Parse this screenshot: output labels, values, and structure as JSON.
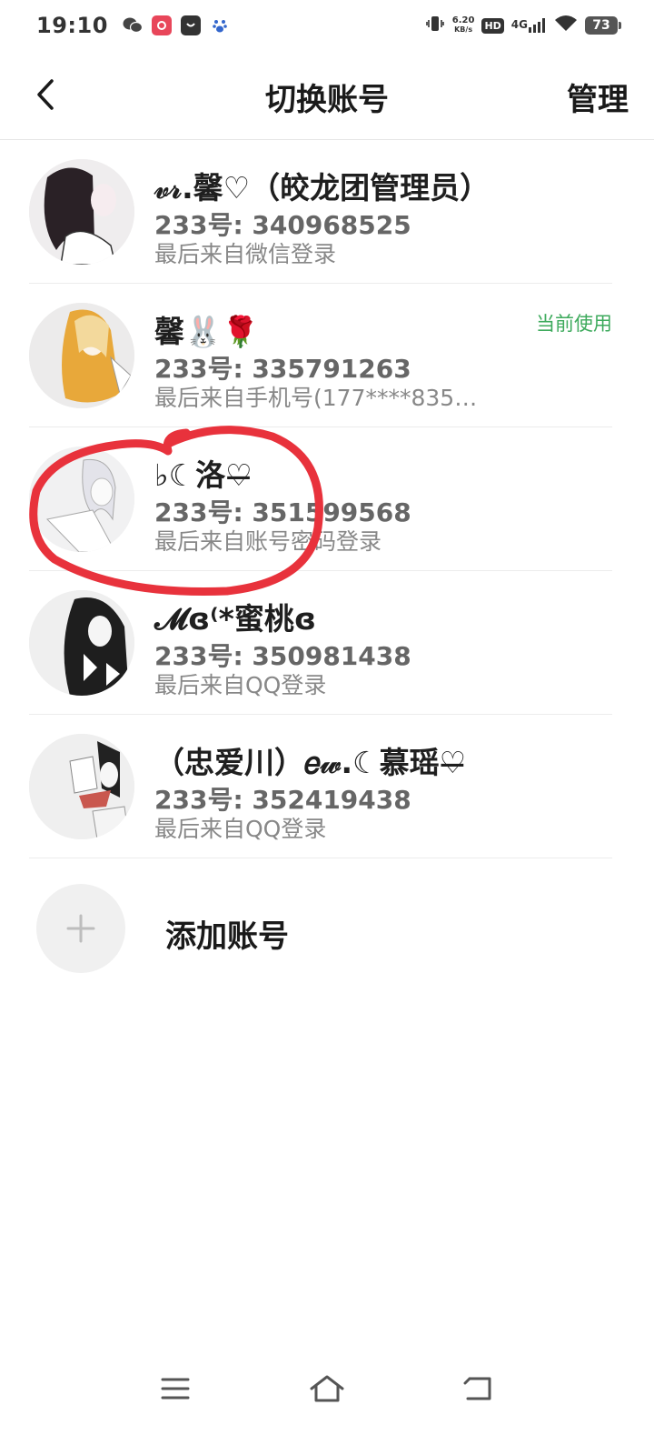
{
  "status_bar": {
    "time": "19:10",
    "speed_value": "6.20",
    "speed_unit": "KB/s",
    "hd": "HD",
    "network": "4G",
    "battery": "73",
    "icons": [
      "wechat-icon",
      "app-red-icon",
      "app-bag-icon",
      "baidu-paw-icon",
      "vibrate-icon",
      "signal-icon",
      "wifi-icon",
      "battery-icon"
    ]
  },
  "header": {
    "title": "切换账号",
    "manage_label": "管理"
  },
  "accounts": [
    {
      "name": "𝓋𝓇.馨♡（皎龙团管理员）",
      "id_line": "233号: 340968525",
      "source": "最后来自微信登录",
      "current": ""
    },
    {
      "name": "馨🐰🌹",
      "id_line": "233号: 335791263",
      "source": "最后来自手机号(177****835…",
      "current": "当前使用"
    },
    {
      "name": "♭☾洛♡̶",
      "id_line": "233号: 351599568",
      "source": "最后来自账号密码登录",
      "current": ""
    },
    {
      "name": "𝓜ɞ⁽*蜜桃ɞ",
      "id_line": "233号: 350981438",
      "source": "最后来自QQ登录",
      "current": ""
    },
    {
      "name": "（忠爱川）𝑒𝓌.☾慕瑶♡̶",
      "id_line": "233号: 352419438",
      "source": "最后来自QQ登录",
      "current": ""
    }
  ],
  "add_account": {
    "label": "添加账号"
  },
  "colors": {
    "current_badge": "#3daa5c",
    "annotation": "#e8323c",
    "divider": "#ececec"
  },
  "nav_bar": {
    "icons": [
      "menu-icon",
      "home-icon",
      "back-icon"
    ]
  }
}
